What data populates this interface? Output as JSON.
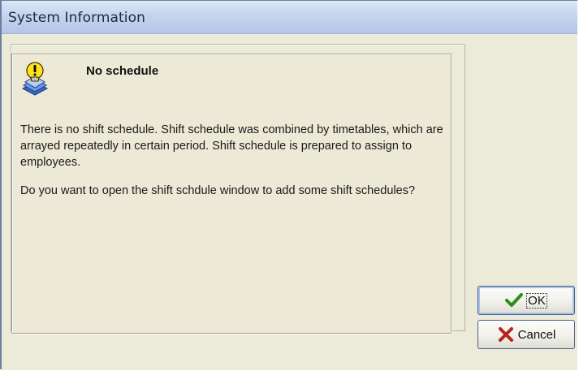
{
  "window": {
    "title": "System Information"
  },
  "message": {
    "icon": "bulb-warning-icon",
    "heading": "No schedule",
    "paragraphs": [
      "There is no shift schedule. Shift schedule was combined by timetables, which are arrayed repeatedly in certain period. Shift schedule is prepared to assign to employees.",
      "Do you want to open the shift schdule window to add some shift schedules?"
    ]
  },
  "buttons": {
    "ok": {
      "label": "OK",
      "icon": "checkmark-icon"
    },
    "cancel": {
      "label": "Cancel",
      "icon": "x-cross-icon"
    }
  },
  "colors": {
    "title_bar": "#c5d5ee",
    "dialog_background": "#ecead9",
    "ok_icon": "#2e8b1f",
    "cancel_icon": "#b3271b"
  }
}
